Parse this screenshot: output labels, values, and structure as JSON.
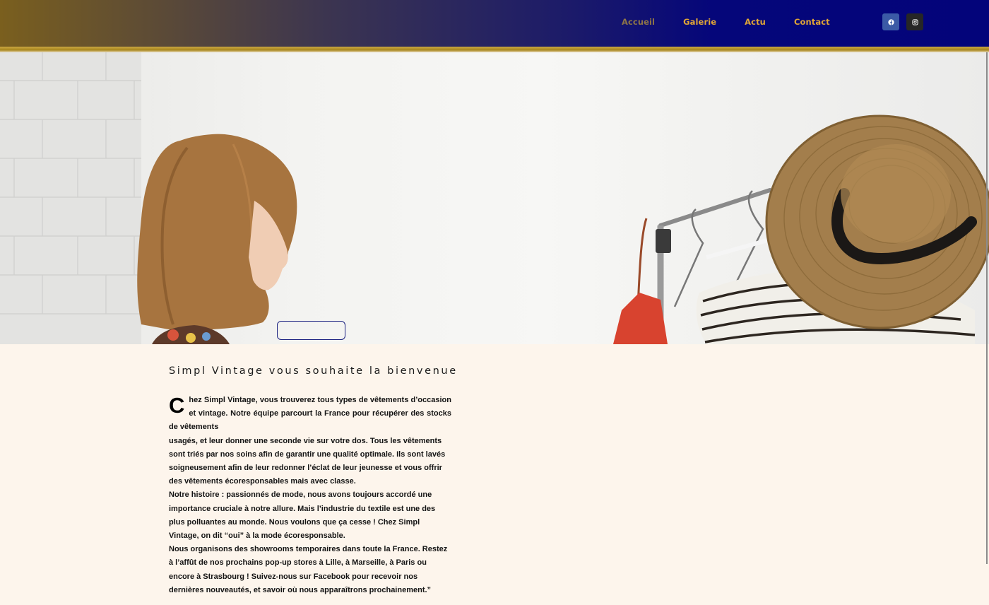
{
  "nav": {
    "items": [
      {
        "label": "Accueil",
        "active": true
      },
      {
        "label": "Galerie",
        "active": false
      },
      {
        "label": "Actu",
        "active": false
      },
      {
        "label": "Contact",
        "active": false
      }
    ]
  },
  "social": {
    "facebook_icon": "facebook-icon",
    "instagram_icon": "instagram-icon"
  },
  "hero": {
    "button_label": ""
  },
  "content": {
    "title": "Simpl Vintage vous souhaite la bienvenue",
    "dropcap": "C",
    "p1_rest": "hez Simpl Vintage, vous trouverez tous types de vêtements d’occasion et vintage. Notre équipe parcourt la France pour récupérer des stocks de vêtements",
    "p1b": "usagés, et leur donner une seconde vie sur votre dos. Tous les vêtements sont triés par nos soins afin de garantir une qualité optimale. Ils sont lavés soigneusement afin de leur redonner l’éclat de leur jeunesse et vous offrir des vêtements écoresponsables mais avec classe.",
    "p2": "Notre histoire : passionnés de mode, nous avons toujours accordé une importance cruciale à notre allure. Mais l’industrie du textile est une des plus polluantes au monde. Nous voulons que ça cesse ! Chez Simpl Vintage, on dit “oui” à la mode écoresponsable.",
    "p3": "Nous organisons des showrooms temporaires dans toute la France. Restez à l’affût de nos prochains pop-up stores à Lille, à Marseille, à Paris ou encore à Strasbourg ! Suivez-nous sur Facebook pour recevoir nos dernières nouveautés, et savoir où nous apparaîtrons prochainement.”"
  }
}
